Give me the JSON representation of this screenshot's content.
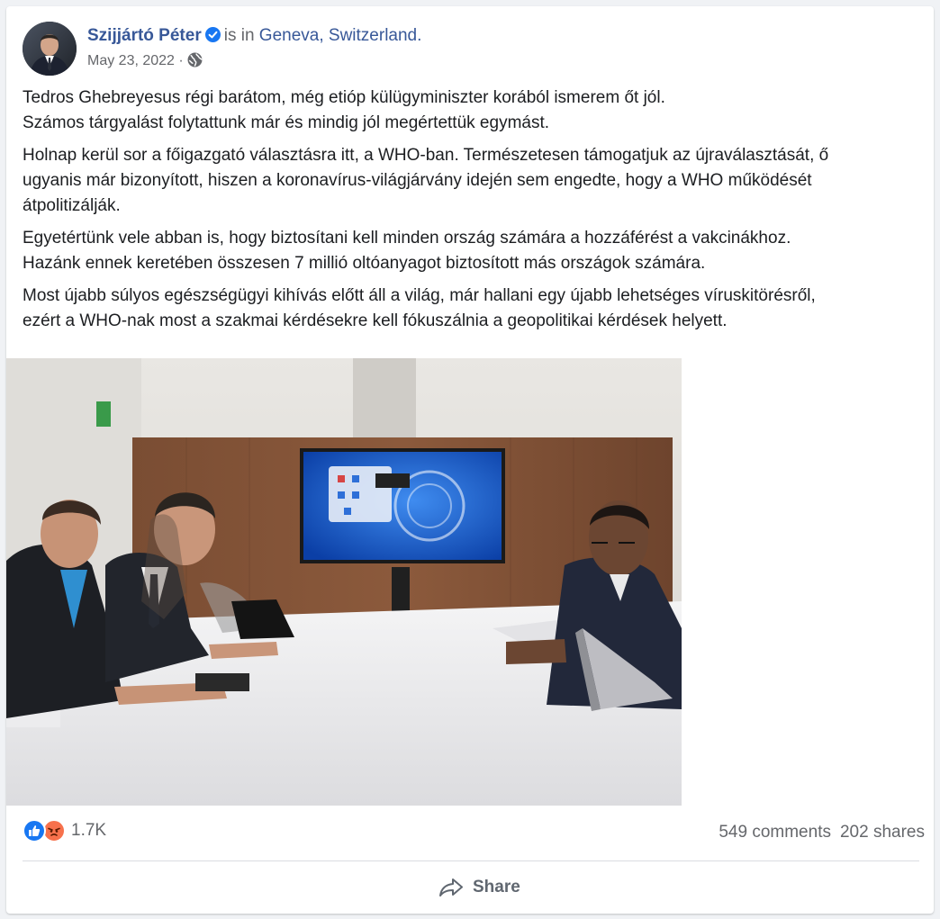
{
  "post": {
    "author": "Szijjártó Péter",
    "checkin_prefix": "is in",
    "location": "Geneva, Switzerland.",
    "date": "May 23, 2022",
    "date_separator": "·",
    "privacy_icon": "globe-icon",
    "verified_icon": "verified-badge-icon",
    "paragraphs": [
      {
        "line1": "Tedros Ghebreyesus régi barátom, még etióp külügyminiszter korából ismerem őt jól.",
        "line2": "Számos tárgyalást folytattunk már és mindig jól megértettük egymást."
      },
      {
        "line1": "Holnap kerül sor a főigazgató választásra itt, a WHO-ban. Természetesen támogatjuk az újraválasztását, ő",
        "line2": "ugyanis már bizonyított, hiszen a koronavírus-világjárvány idején sem engedte, hogy a WHO működését",
        "line3": "átpolitizálják."
      },
      {
        "line1": "Egyetértünk vele abban is, hogy biztosítani kell minden ország számára a hozzáférést a vakcinákhoz.",
        "line2": "Hazánk ennek keretében összesen 7 millió oltóanyagot biztosított más országok számára."
      },
      {
        "line1": "Most újabb súlyos egészségügyi kihívás előtt áll a világ, már hallani egy újabb lehetséges víruskitörésről,",
        "line2": "ezért a WHO-nak most a szakmai kérdésekre kell fókuszálnia a geopolitikai kérdések helyett."
      }
    ]
  },
  "stats": {
    "reaction_icons": [
      "like-icon",
      "angry-icon"
    ],
    "reaction_count": "1.7K",
    "comments": "549 comments",
    "shares": "202 shares"
  },
  "actions": {
    "share_label": "Share",
    "share_icon": "share-arrow-icon"
  },
  "colors": {
    "link": "#385898",
    "secondary_text": "#65676b",
    "body_text": "#1c1e21",
    "like_blue": "#1877f2",
    "angry_orange": "#f7714c"
  }
}
